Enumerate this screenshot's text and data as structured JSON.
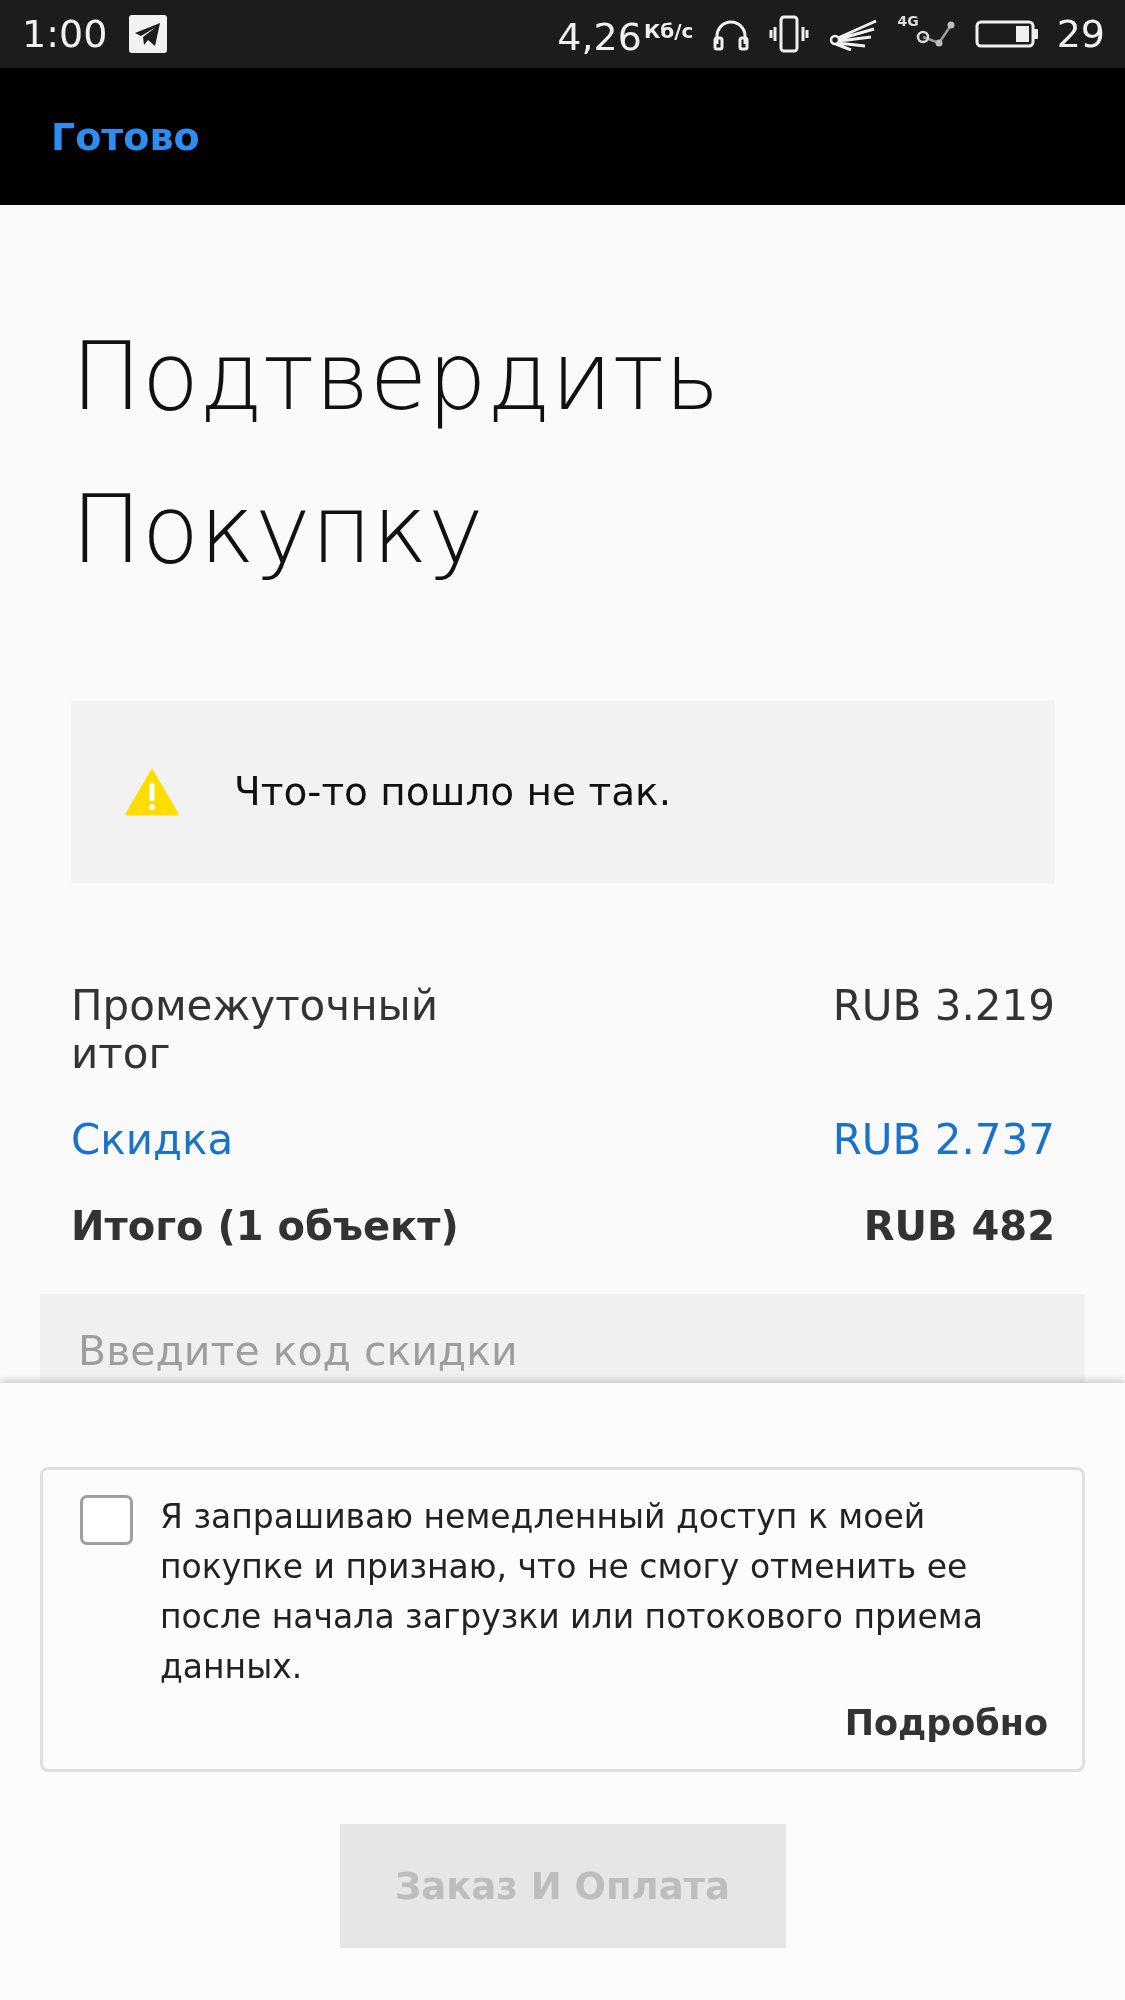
{
  "status_bar": {
    "time": "1:00",
    "net_speed": "4,26",
    "net_speed_unit": "Кб/с",
    "network_type": "4G",
    "battery": "29"
  },
  "nav_bar": {
    "done": "Готово"
  },
  "title": "Подтвердить Покупку",
  "alert": {
    "kind": "warning",
    "message": "Что-то пошло не так."
  },
  "summary": [
    {
      "kind": "subtotal",
      "label": "Промежуточный итог",
      "value": "RUB 3.219"
    },
    {
      "kind": "discount",
      "label": "Скидка",
      "value": "RUB 2.737"
    },
    {
      "kind": "total",
      "label": "Итого (1 объект)",
      "value": "RUB 482"
    }
  ],
  "discount_code": {
    "placeholder": "Введите код скидки"
  },
  "consent": {
    "checked": false,
    "text": "Я запрашиваю немедленный доступ к моей покупке и признаю, что не смогу отменить ее после начала загрузки или потокового приема данных.",
    "link": "Подробно"
  },
  "order_button": {
    "label": "Заказ И Оплата",
    "disabled": true
  }
}
